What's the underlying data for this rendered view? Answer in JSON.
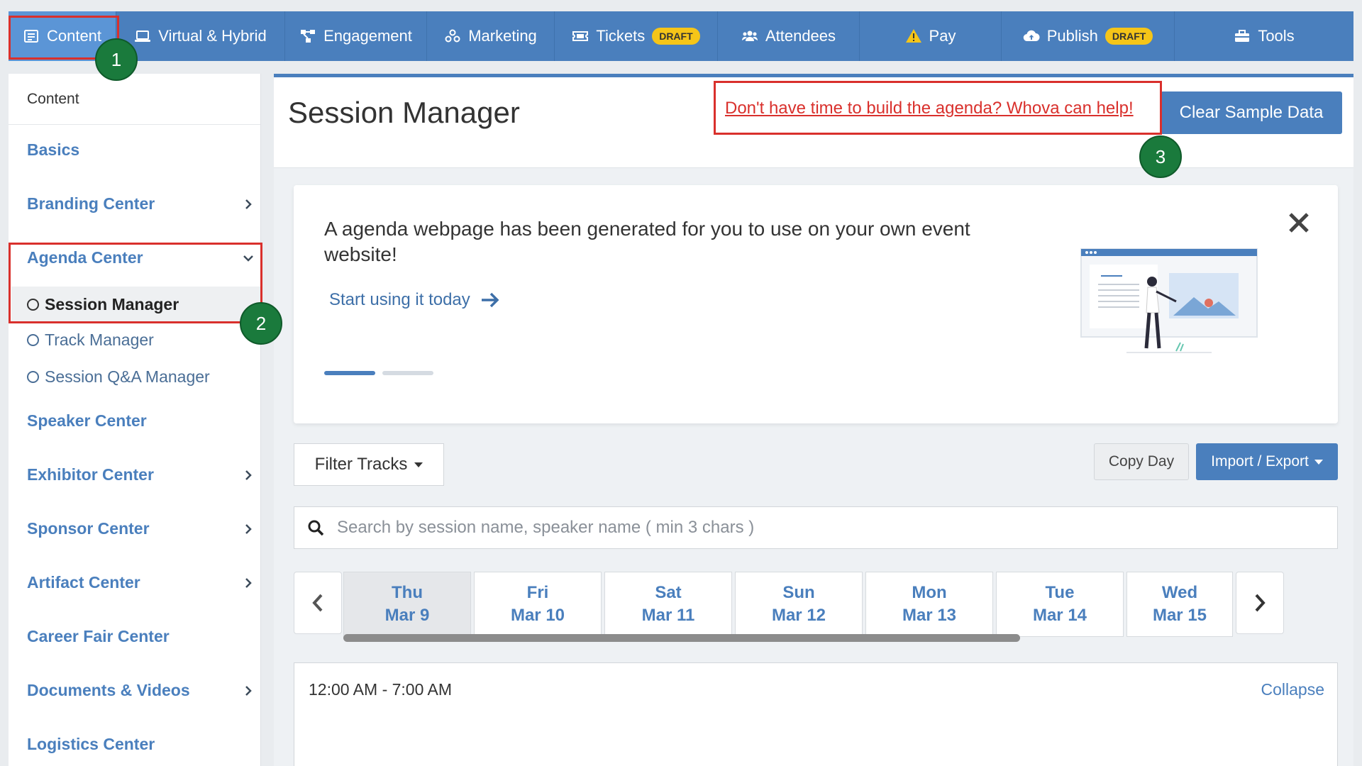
{
  "nav": {
    "items": [
      {
        "label": "Content",
        "icon": "list-icon"
      },
      {
        "label": "Virtual & Hybrid",
        "icon": "laptop-icon"
      },
      {
        "label": "Engagement",
        "icon": "network-icon"
      },
      {
        "label": "Marketing",
        "icon": "people-share-icon"
      },
      {
        "label": "Tickets",
        "icon": "ticket-icon",
        "badge": "DRAFT"
      },
      {
        "label": "Attendees",
        "icon": "users-icon"
      },
      {
        "label": "Pay",
        "icon": "warning-icon"
      },
      {
        "label": "Publish",
        "icon": "cloud-upload-icon",
        "badge": "DRAFT"
      },
      {
        "label": "Tools",
        "icon": "toolbox-icon"
      }
    ]
  },
  "sidebar": {
    "header": "Content",
    "items": [
      {
        "label": "Basics"
      },
      {
        "label": "Branding Center"
      },
      {
        "label": "Agenda Center"
      },
      {
        "label": "Speaker Center"
      },
      {
        "label": "Exhibitor Center"
      },
      {
        "label": "Sponsor Center"
      },
      {
        "label": "Artifact Center"
      },
      {
        "label": "Career Fair Center"
      },
      {
        "label": "Documents & Videos"
      },
      {
        "label": "Logistics Center"
      }
    ],
    "agenda_sub": [
      {
        "label": "Session Manager"
      },
      {
        "label": "Track Manager"
      },
      {
        "label": "Session Q&A Manager"
      }
    ]
  },
  "main": {
    "title": "Session Manager",
    "help_link": "Don't have time to build the agenda? Whova can help!",
    "clear_button": "Clear Sample Data",
    "banner": {
      "text": "A agenda webpage has been generated for you to use on your own event website!",
      "link": "Start using it today"
    },
    "filter_button": "Filter Tracks",
    "copy_button": "Copy Day",
    "import_button": "Import / Export",
    "search_placeholder": "Search by session name, speaker name ( min 3 chars )",
    "days": [
      {
        "dow": "Thu",
        "date": "Mar 9"
      },
      {
        "dow": "Fri",
        "date": "Mar 10"
      },
      {
        "dow": "Sat",
        "date": "Mar 11"
      },
      {
        "dow": "Sun",
        "date": "Mar 12"
      },
      {
        "dow": "Mon",
        "date": "Mar 13"
      },
      {
        "dow": "Tue",
        "date": "Mar 14"
      },
      {
        "dow": "Wed",
        "date": "Mar 15"
      }
    ],
    "timeslot": {
      "time": "12:00 AM - 7:00 AM",
      "action": "Collapse"
    }
  },
  "annotations": {
    "markers": [
      "1",
      "2",
      "3"
    ]
  },
  "colors": {
    "primary": "#4a7fbd",
    "badge": "#f5c518",
    "annotation_red": "#d9302c",
    "marker_green": "#1a7a3c"
  }
}
